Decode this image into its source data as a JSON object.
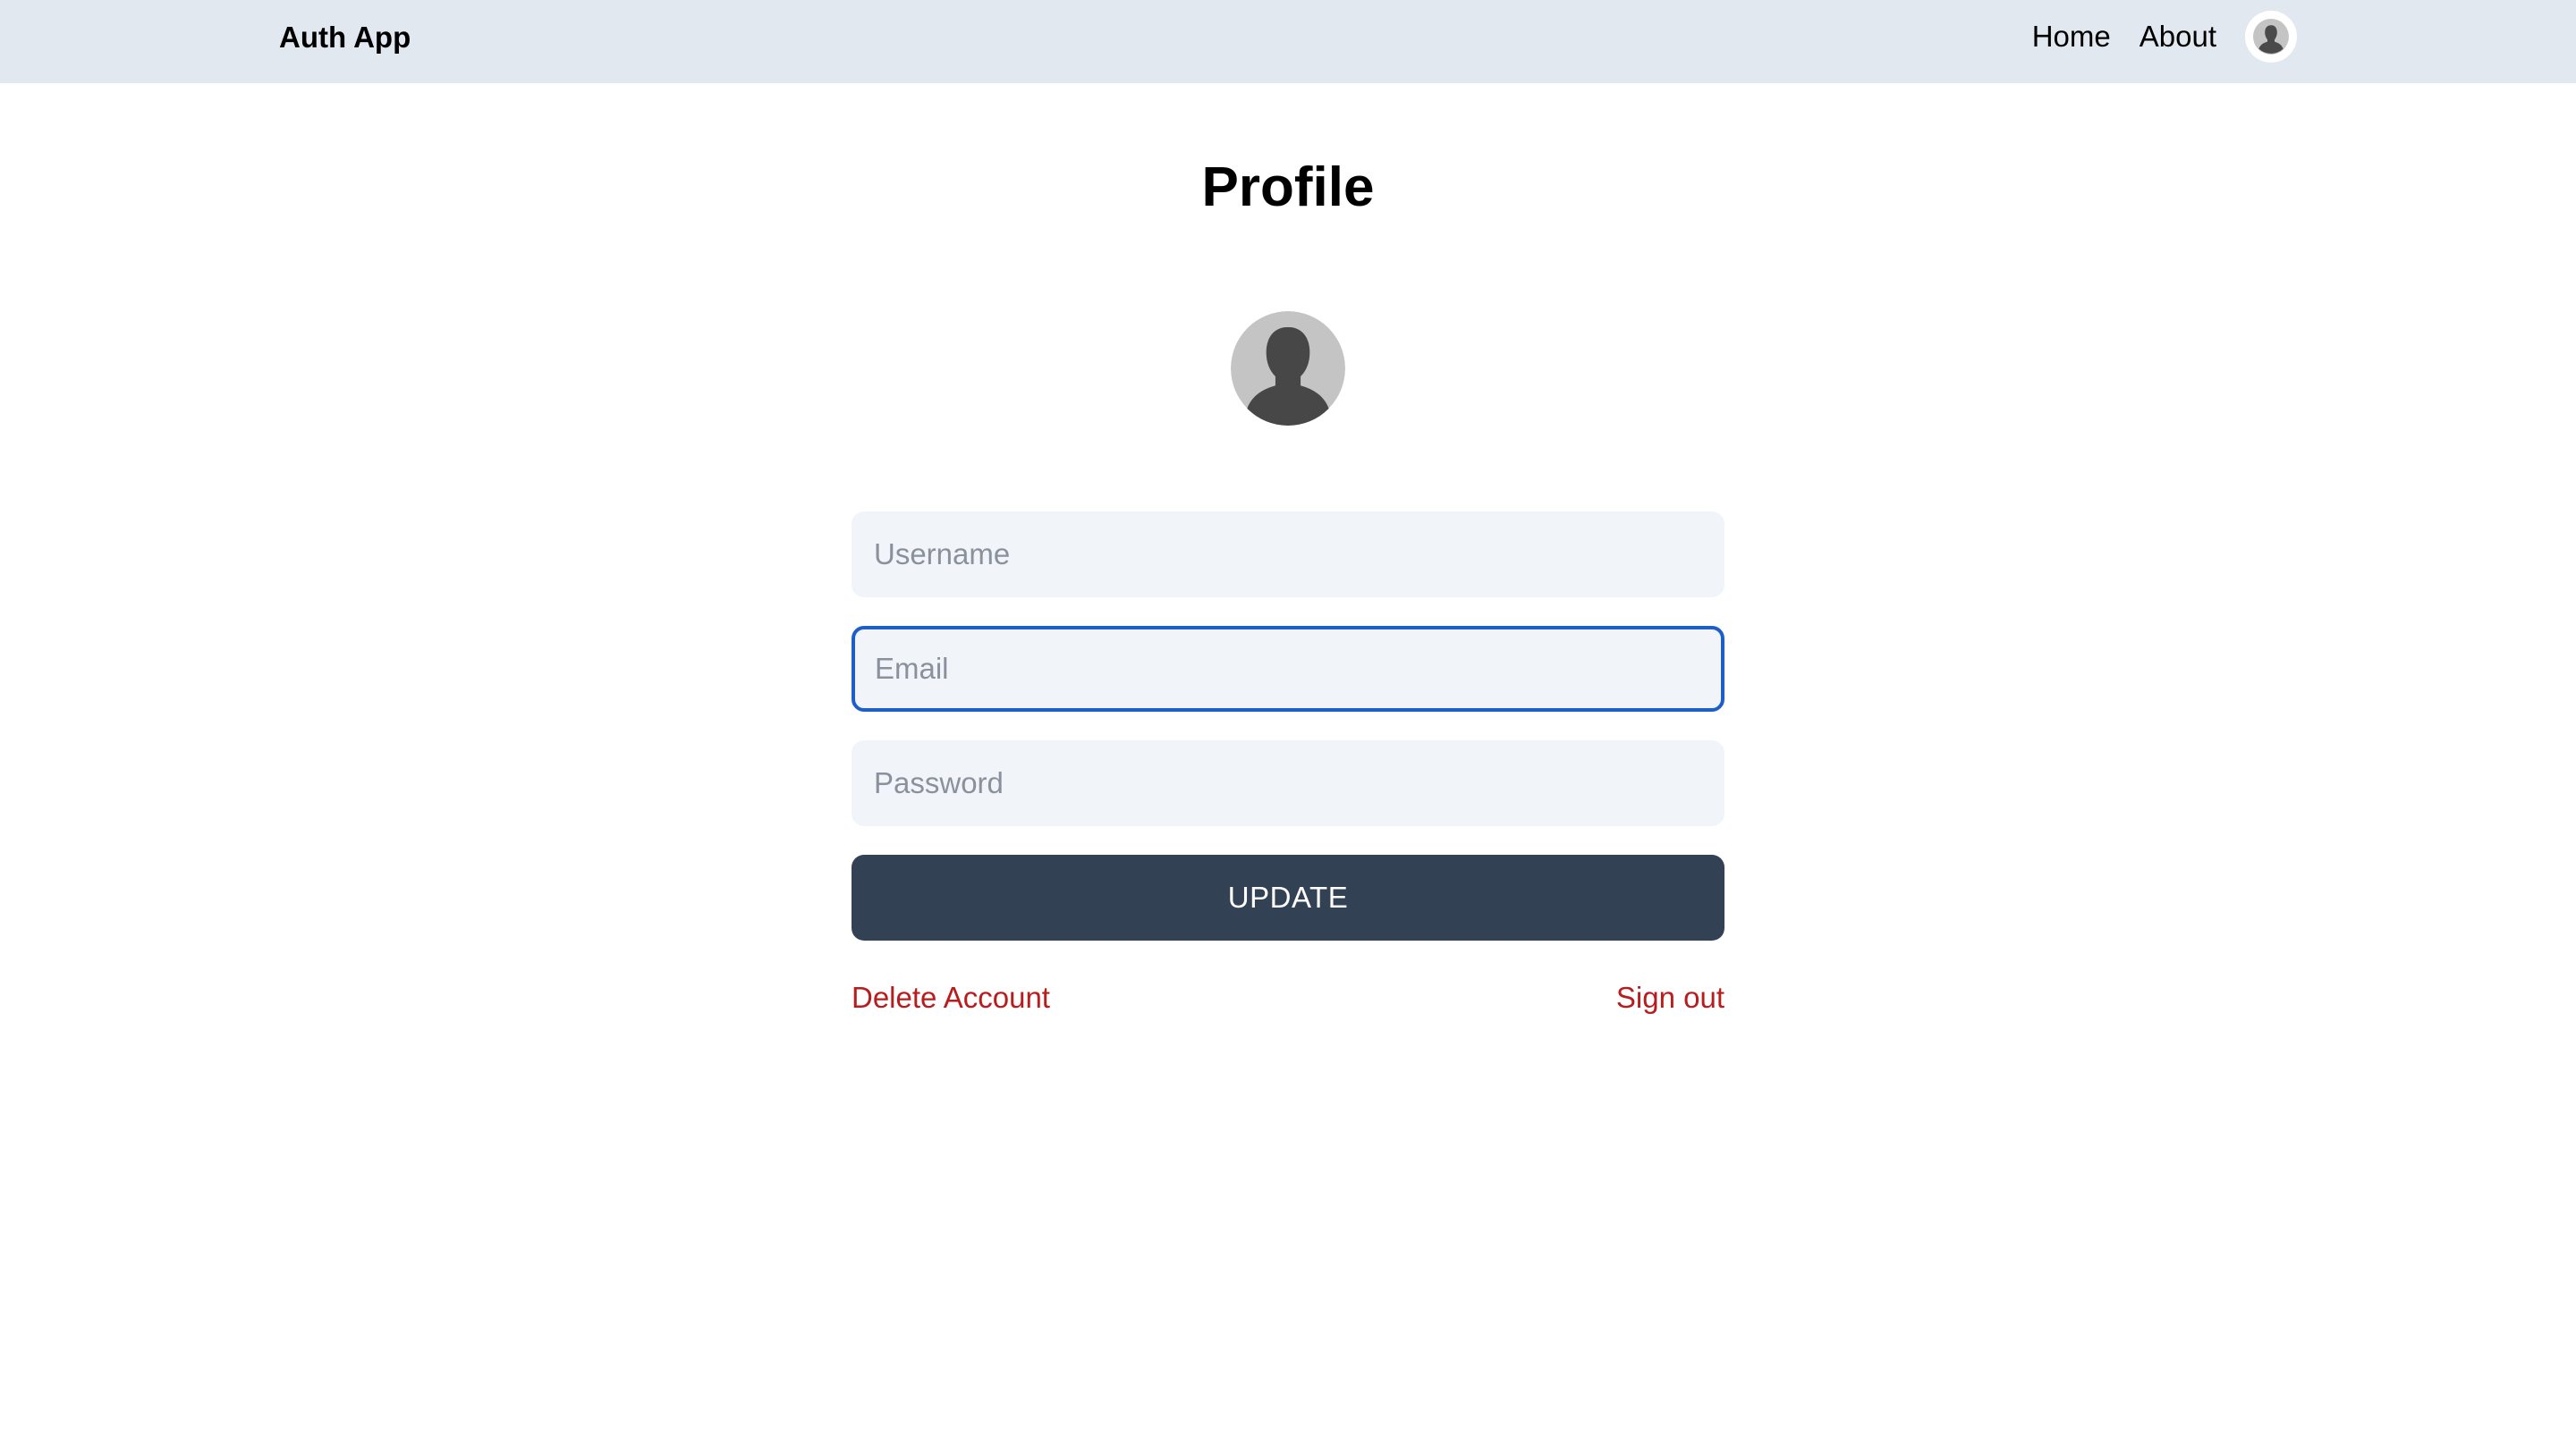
{
  "navbar": {
    "brand": "Auth App",
    "links": {
      "home": "Home",
      "about": "About"
    },
    "avatar_icon": "user-silhouette-icon",
    "background": "#e2e8f0"
  },
  "main": {
    "title": "Profile",
    "avatar_icon": "user-silhouette-icon",
    "form": {
      "username": {
        "placeholder": "Username",
        "value": ""
      },
      "email": {
        "placeholder": "Email",
        "value": "",
        "focused": true
      },
      "password": {
        "placeholder": "Password",
        "value": ""
      },
      "submit_label": "UPDATE"
    },
    "actions": {
      "delete_account": "Delete Account",
      "sign_out": "Sign out"
    }
  },
  "colors": {
    "button_bg": "#334155",
    "danger": "#b91c1c",
    "input_bg": "#f1f5f9",
    "focus_ring": "#1d5fc9"
  }
}
